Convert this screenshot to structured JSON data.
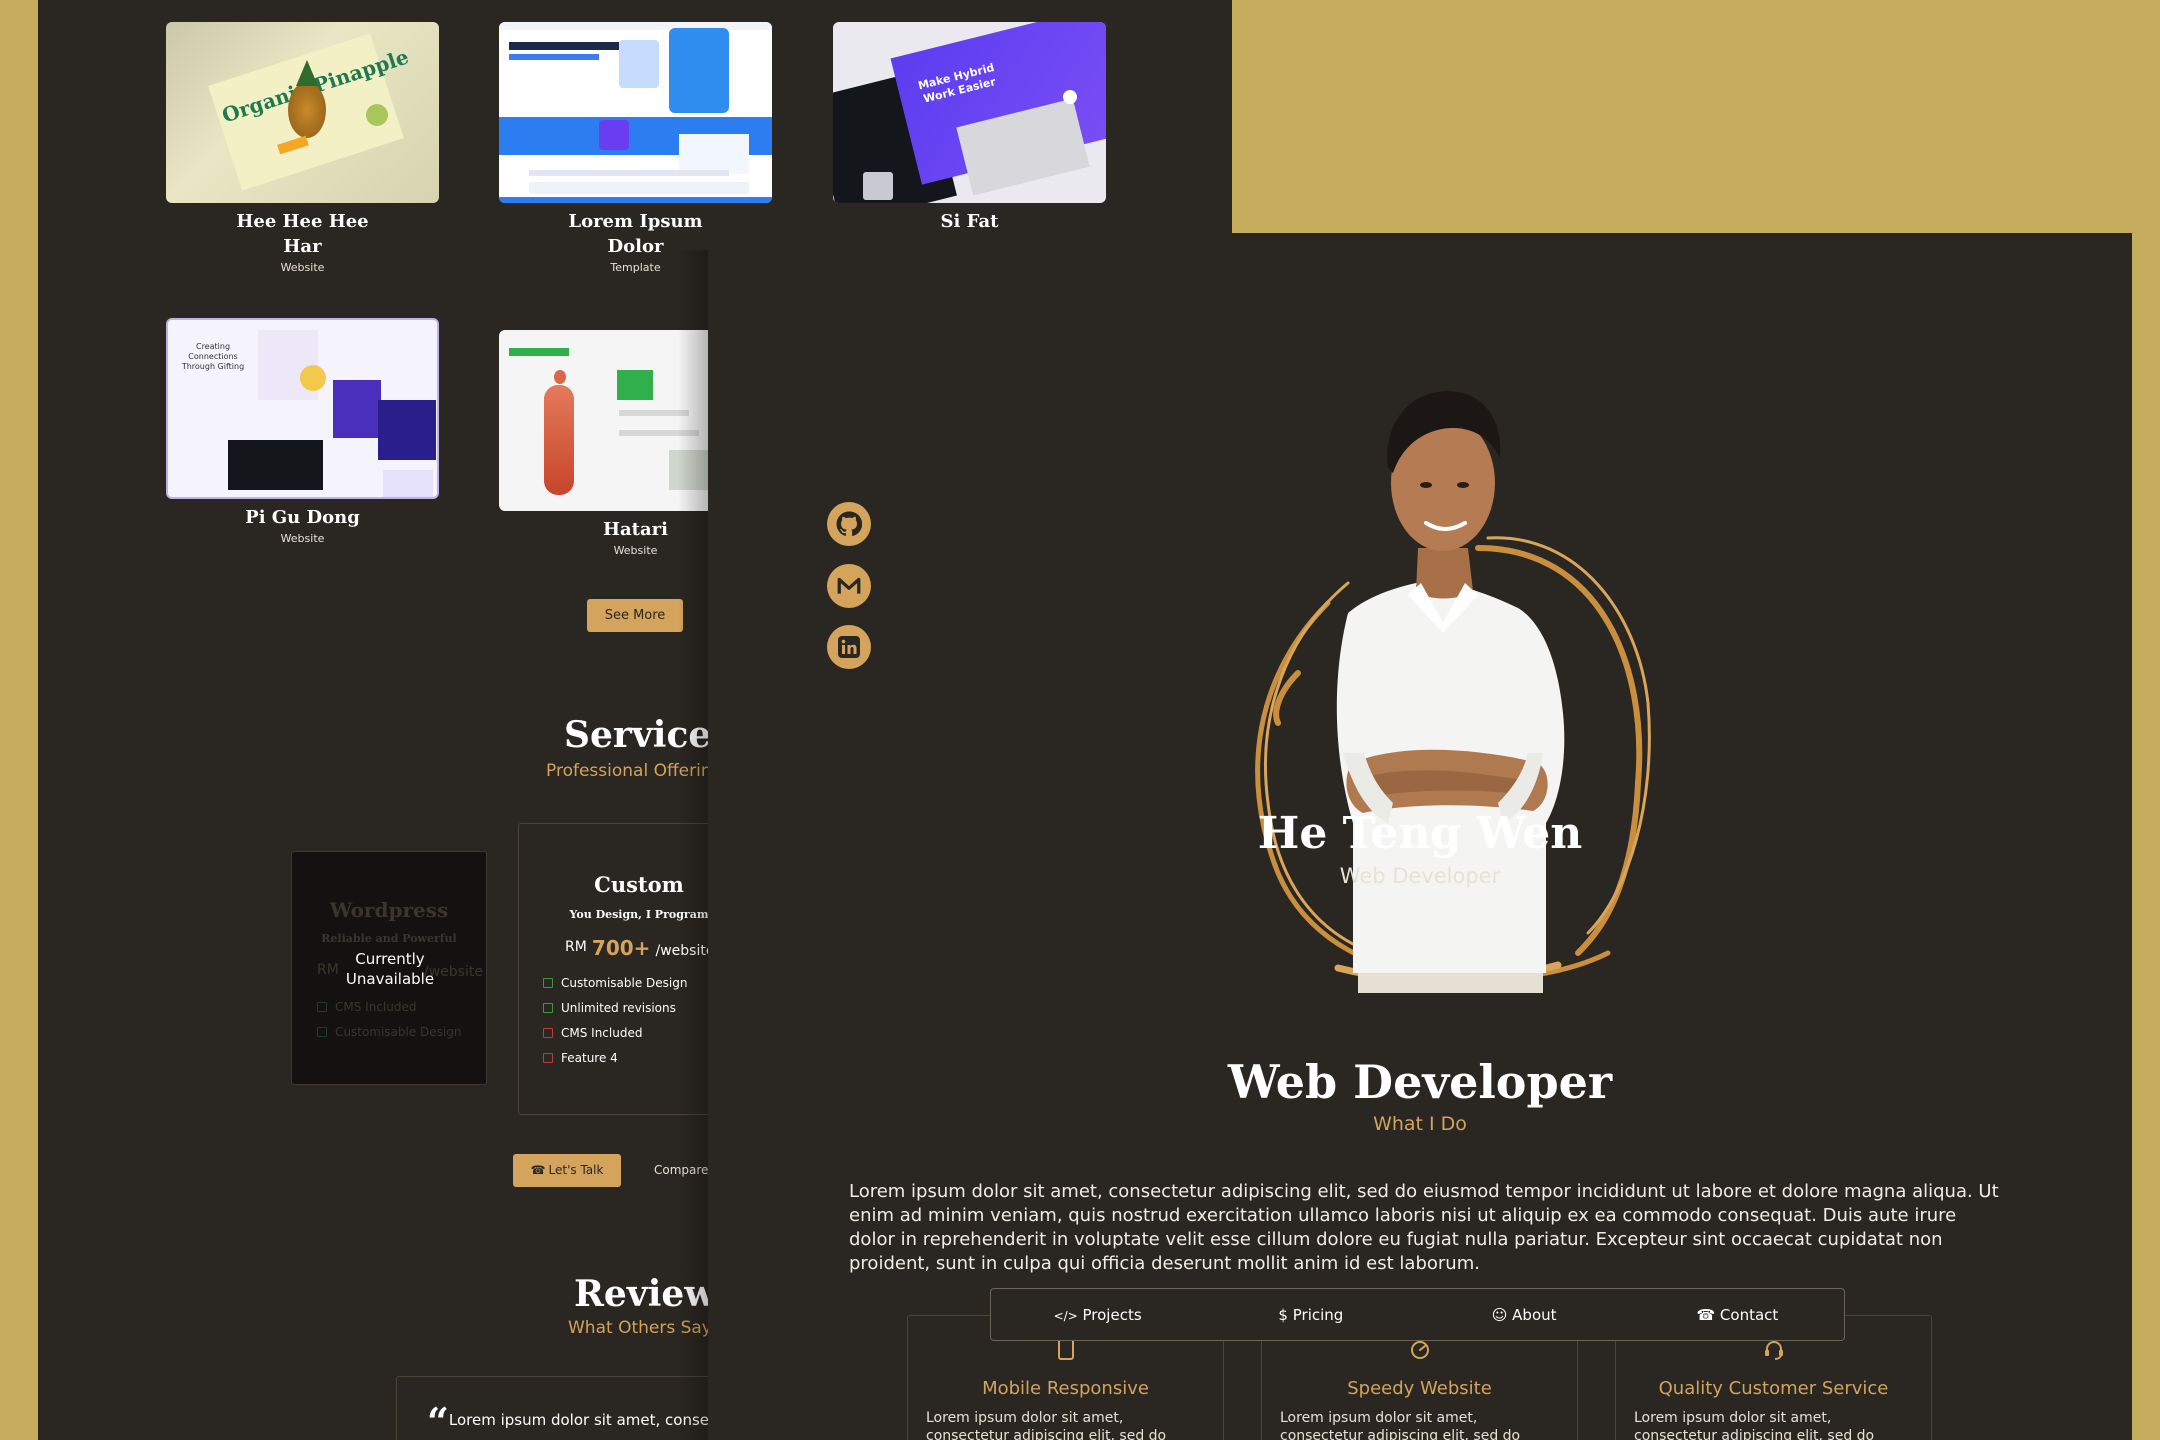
{
  "projects": [
    {
      "title": "Hee Hee Hee Har",
      "type": "Website"
    },
    {
      "title": "Lorem Ipsum Dolor",
      "type": "Template"
    },
    {
      "title": "Si Fat",
      "type": ""
    },
    {
      "title": "Pi Gu Dong",
      "type": "Website"
    },
    {
      "title": "Hatari",
      "type": "Website"
    }
  ],
  "thumb_text": {
    "organic": "Organic Pinapple",
    "hybrid": "Make Hybrid Work Easier",
    "gifting": "Creating Connections Through Gifting"
  },
  "see_more": "See More",
  "services": {
    "title": "Services",
    "subtitle": "Professional Offerings",
    "wordpress": {
      "title": "Wordpress",
      "tagline": "Reliable and Powerful",
      "price_prefix": "RM",
      "price_suffix": "/website",
      "overlay": "Currently Unavailable",
      "features": [
        "CMS Included",
        "Customisable Design"
      ]
    },
    "custom": {
      "title": "Custom",
      "tagline": "You Design, I Program",
      "price_prefix": "RM",
      "price": "700+",
      "price_suffix": "/website",
      "features": [
        {
          "label": "Customisable Design",
          "included": true
        },
        {
          "label": "Unlimited revisions",
          "included": true
        },
        {
          "label": "CMS Included",
          "included": false
        },
        {
          "label": "Feature 4",
          "included": false
        }
      ]
    },
    "lets_talk": "Let's Talk",
    "compare": "Compare"
  },
  "review": {
    "title": "Review",
    "subtitle": "What Others Say",
    "quote": "Lorem ipsum dolor sit amet, consectetur"
  },
  "hero": {
    "name": "He Teng Wen",
    "role": "Web Developer"
  },
  "about": {
    "title": "Web Developer",
    "subtitle": "What I Do",
    "paragraph": "Lorem ipsum dolor sit amet, consectetur adipiscing elit, sed do eiusmod tempor incididunt ut labore et dolore magna aliqua. Ut enim ad minim veniam, quis nostrud exercitation ullamco laboris nisi ut aliquip ex ea commodo consequat. Duis aute irure dolor in reprehenderit in voluptate velit esse cillum dolore eu fugiat nulla pariatur. Excepteur sint occaecat cupidatat non proident, sunt in culpa qui officia deserunt mollit anim id est laborum."
  },
  "nav": {
    "projects": "Projects",
    "pricing": "Pricing",
    "about": "About",
    "contact": "Contact"
  },
  "features": [
    {
      "title": "Mobile Responsive",
      "desc": "Lorem ipsum dolor sit amet, consectetur adipiscing elit, sed do",
      "icon": "phone-icon"
    },
    {
      "title": "Speedy Website",
      "desc": "Lorem ipsum dolor sit amet, consectetur adipiscing elit, sed do",
      "icon": "gauge-icon"
    },
    {
      "title": "Quality Customer Service",
      "desc": "Lorem ipsum dolor sit amet, consectetur adipiscing elit, sed do",
      "icon": "headset-icon"
    }
  ],
  "colors": {
    "background": "#c6ac5d",
    "page": "#2a2621",
    "accent": "#d4a35c",
    "included": "#3a9a3a",
    "excluded": "#c23a3a"
  }
}
